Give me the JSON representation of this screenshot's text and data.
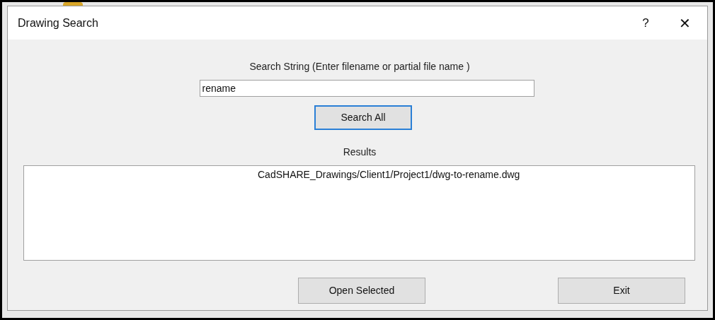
{
  "window": {
    "title": "Drawing Search",
    "help": "?",
    "close": "✕"
  },
  "search": {
    "label": "Search String (Enter filename or partial file name )",
    "value": "rename"
  },
  "search_button": {
    "label": "Search All",
    "focused": true
  },
  "results": {
    "label": "Results",
    "items": [
      {
        "text": "CadSHARE_Drawings/Client1/Project1/dwg-to-rename.dwg",
        "selected": false
      }
    ]
  },
  "buttons": [
    {
      "label": "Open Selected"
    },
    {
      "label": "Exit"
    }
  ]
}
